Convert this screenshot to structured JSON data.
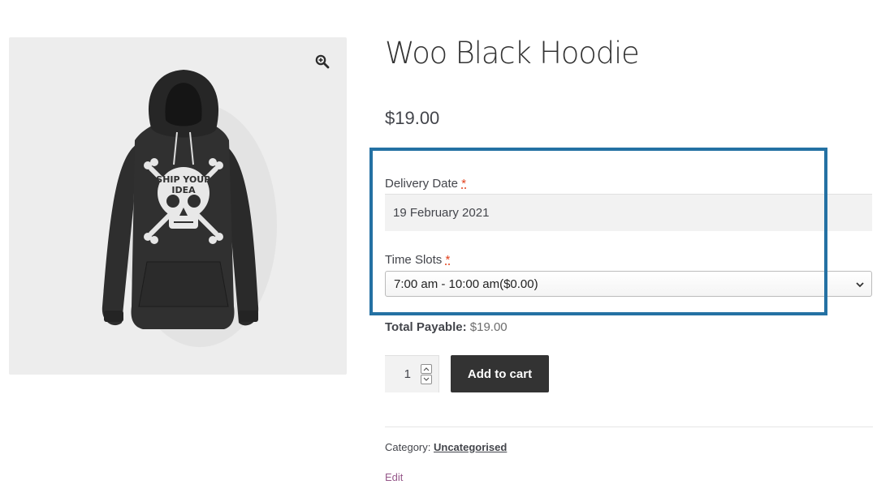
{
  "product": {
    "title": "Woo Black Hoodie",
    "price": "$19.00"
  },
  "gallery": {
    "image_alt": "Black hoodie with skull graphic",
    "zoom_icon": "magnifier-plus-icon",
    "print_text": "SHIP YOUR IDEA"
  },
  "delivery": {
    "label": "Delivery Date",
    "required_mark": "*",
    "value": "19 February 2021"
  },
  "time_slots": {
    "label": "Time Slots",
    "required_mark": "*",
    "selected": "7:00 am - 10:00 am($0.00)"
  },
  "total": {
    "label": "Total Payable:",
    "value": "$19.00"
  },
  "cart": {
    "quantity": "1",
    "add_label": "Add to cart"
  },
  "meta": {
    "category_label": "Category:",
    "category_value": "Uncategorised",
    "edit_label": "Edit"
  },
  "colors": {
    "highlight_border": "#2471a3",
    "button_bg": "#333333",
    "edit_link": "#96588a",
    "required": "#e2401c"
  }
}
